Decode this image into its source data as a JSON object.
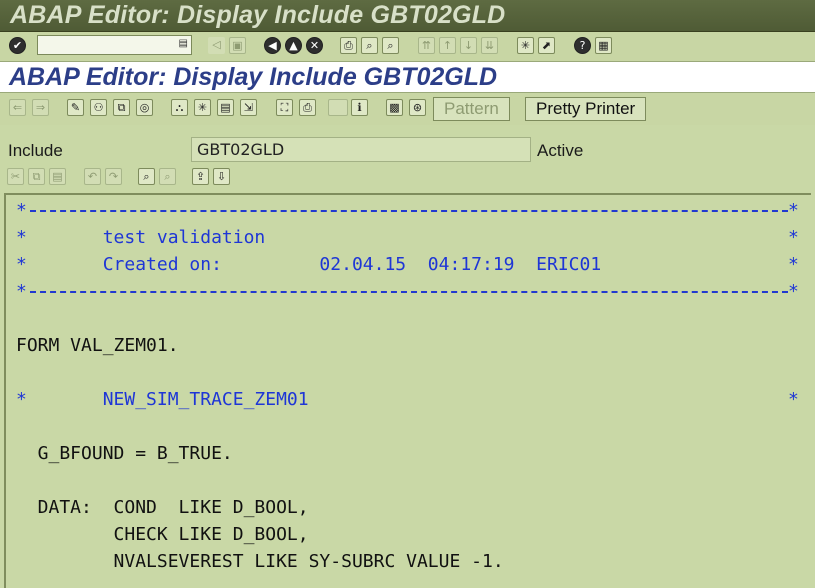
{
  "window": {
    "title": "ABAP Editor: Display Include GBT02GLD"
  },
  "screen": {
    "title": "ABAP Editor: Display Include GBT02GLD"
  },
  "command_field": {
    "value": "",
    "placeholder": ""
  },
  "app_toolbar": {
    "pattern_label": "Pattern",
    "pretty_printer_label": "Pretty Printer"
  },
  "header": {
    "include_label": "Include",
    "include_value": "GBT02GLD",
    "status": "Active"
  },
  "code": {
    "comment_star": "*",
    "header_line1": "*       test validation",
    "header_line2": "*       Created on:         02.04.15  04:17:19  ERIC01",
    "form_line": "FORM VAL_ZEM01.",
    "trace_line": "*       NEW_SIM_TRACE_ZEM01",
    "assign_line": "  G_BFOUND = B_TRUE.",
    "data_line1": "  DATA:  COND  LIKE D_BOOL,",
    "data_line2": "         CHECK LIKE D_BOOL,",
    "data_line3": "         NVALSEVEREST LIKE SY-SUBRC VALUE -1."
  },
  "colors": {
    "title_bar": "#55613a",
    "background": "#c9d8a6",
    "comment_text": "#1e36d6",
    "screen_title_text": "#2c3e88"
  }
}
